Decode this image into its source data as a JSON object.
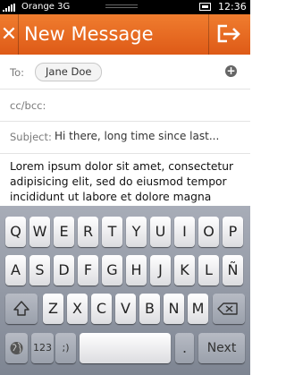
{
  "status_bar": {
    "carrier": "Orange 3G",
    "time": "12:36"
  },
  "header": {
    "title": "New Message",
    "close_glyph": "✕"
  },
  "form": {
    "to_label": "To:",
    "recipient": "Jane Doe",
    "add_glyph": "+",
    "cc_label": "cc/bcc:",
    "subject_label": "Subject:",
    "subject_value": "Hi there, long time since last...",
    "body": "Lorem ipsum dolor sit amet, consectetur adipisicing elit, sed do eiusmod tempor incididunt ut labore et dolore magna aliqua. Ut enim ad minim veniam, quis"
  },
  "keyboard": {
    "row1": [
      "Q",
      "W",
      "E",
      "R",
      "T",
      "Y",
      "U",
      "I",
      "O",
      "P"
    ],
    "row2": [
      "A",
      "S",
      "D",
      "F",
      "G",
      "H",
      "J",
      "K",
      "L",
      "Ñ"
    ],
    "row3": [
      "Z",
      "X",
      "C",
      "V",
      "B",
      "N",
      "M"
    ],
    "numbers_label": "123",
    "symbols_label": ";)",
    "period_label": ".",
    "next_label": "Next"
  },
  "colors": {
    "header": "#e8671f",
    "keyboard": "#8d939f"
  }
}
